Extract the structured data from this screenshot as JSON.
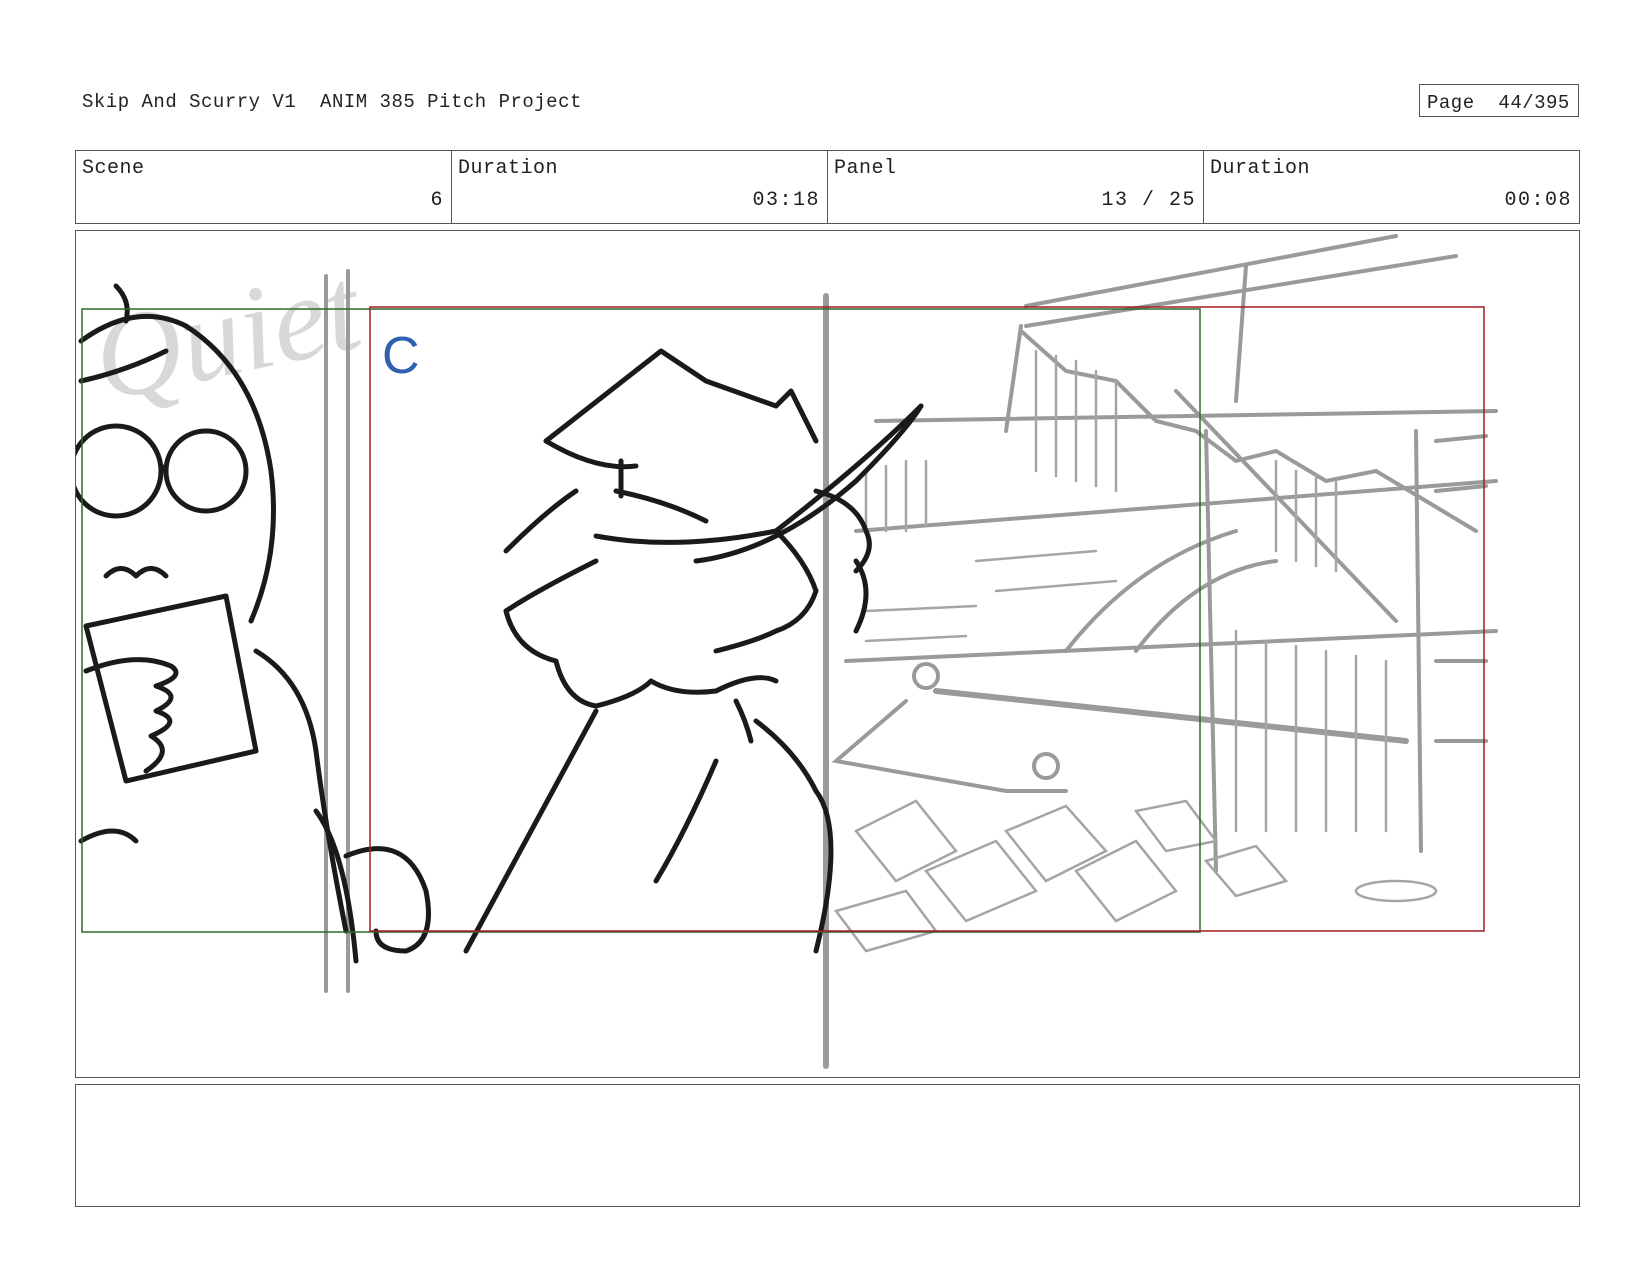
{
  "header": {
    "title": "Skip And Scurry V1  ANIM 385 Pitch Project",
    "page_label": "Page",
    "page_value": "44/395"
  },
  "info": {
    "scene_label": "Scene",
    "scene_value": "6",
    "scene_duration_label": "Duration",
    "scene_duration_value": "03:18",
    "panel_label": "Panel",
    "panel_value": "13 / 25",
    "panel_duration_label": "Duration",
    "panel_duration_value": "00:08"
  },
  "panel_art": {
    "camera_label": "C",
    "camera_label_color": "#2f5fb0",
    "frame_green_color": "#2d6a2d",
    "frame_red_color": "#a01c24",
    "watermark_text": "Quiet"
  },
  "notes": {
    "text": ""
  }
}
